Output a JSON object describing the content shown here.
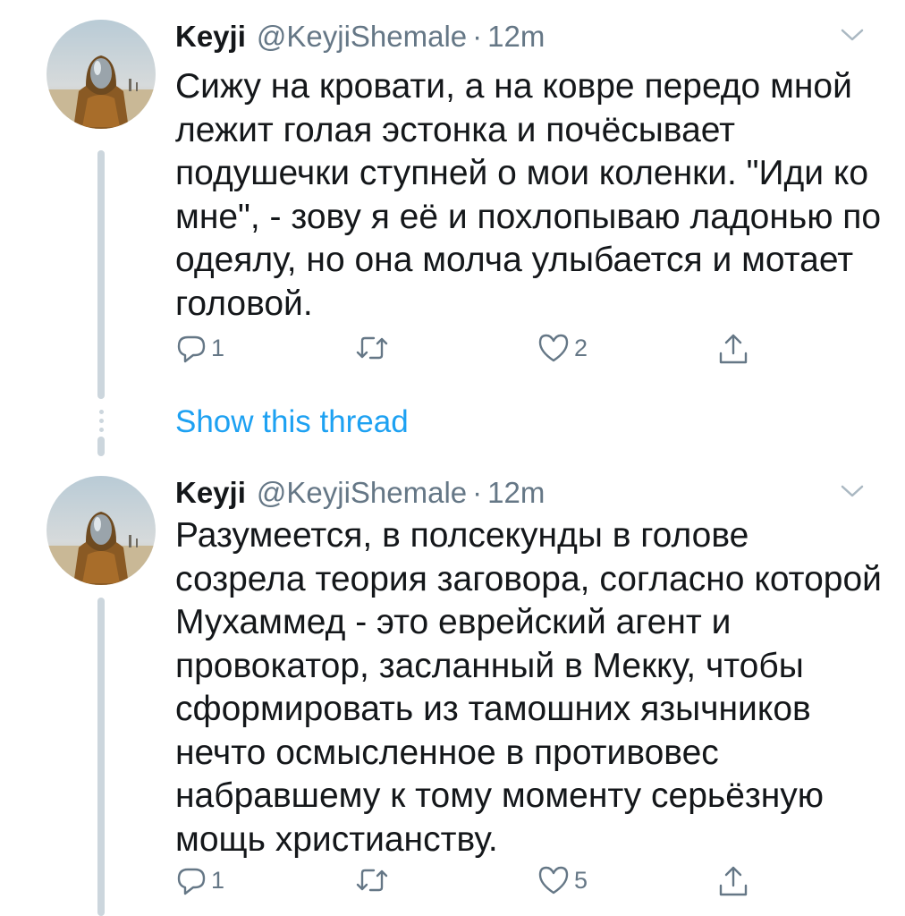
{
  "tweets": [
    {
      "name": "Keyji",
      "handle": "@KeyjiShemale",
      "separator": "·",
      "time": "12m",
      "text": "Сижу на кровати, а на ковре передо мной лежит голая эстонка и почёсывает подушечки ступней о мои коленки. \"Иди ко мне\", - зову я её и похлопываю ладонью по одеялу, но она молча улыбается и мотает головой.",
      "reply_count": "1",
      "retweet_count": "",
      "like_count": "2"
    },
    {
      "name": "Keyji",
      "handle": "@KeyjiShemale",
      "separator": "·",
      "time": "12m",
      "text": "Разумеется, в полсекунды в голове созрела теория заговора, согласно которой Мухаммед - это еврейский агент и провокатор, засланный в Мекку, чтобы сформировать из тамошних язычников нечто осмысленное в противовес набравшему к тому моменту серьёзную мощь христианству.",
      "reply_count": "1",
      "retweet_count": "",
      "like_count": "5"
    }
  ],
  "show_thread_label": "Show this thread",
  "colors": {
    "accent": "#1da1f2",
    "secondary": "#657786",
    "line": "#ccd6dd",
    "text": "#14171a"
  },
  "icons": [
    "reply-icon",
    "retweet-icon",
    "like-icon",
    "share-icon",
    "chevron-down-icon"
  ]
}
